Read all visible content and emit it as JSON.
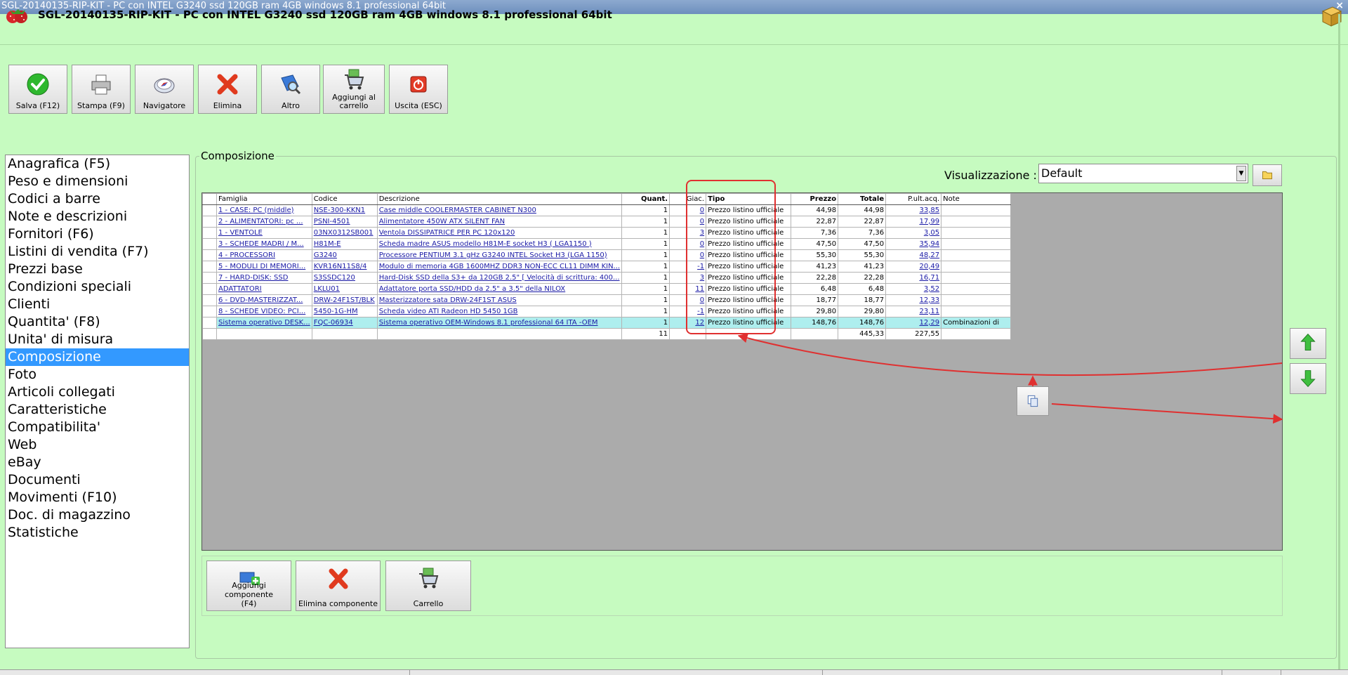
{
  "window": {
    "title": "SGL-20140135-RIP-KIT - PC con INTEL G3240 ssd 120GB ram 4GB windows 8.1 professional 64bit",
    "close_glyph": "×"
  },
  "header": {
    "title": "SGL-20140135-RIP-KIT - PC con INTEL G3240 ssd 120GB ram 4GB windows 8.1 professional 64bit"
  },
  "toolbar": {
    "save": "Salva (F12)",
    "print": "Stampa (F9)",
    "navigator": "Navigatore",
    "delete": "Elimina",
    "other": "Altro",
    "add_cart_1": "Aggiungi al",
    "add_cart_2": "carrello",
    "exit": "Uscita (ESC)"
  },
  "sidebar": {
    "items": [
      "Anagrafica (F5)",
      "Peso e dimensioni",
      "Codici a barre",
      "Note e descrizioni",
      "Fornitori (F6)",
      "Listini di vendita (F7)",
      "Prezzi base",
      "Condizioni speciali",
      "Clienti",
      "Quantita' (F8)",
      "Unita' di misura",
      "Composizione",
      "Foto",
      "Articoli collegati",
      "Caratteristiche",
      "Compatibilita'",
      "Web",
      "eBay",
      "Documenti",
      "Movimenti (F10)",
      "Doc. di magazzino",
      "Statistiche"
    ],
    "active_index": 11
  },
  "composizione": {
    "group_title": "Composizione",
    "view_label": "Visualizzazione :",
    "view_value": "Default",
    "columns": {
      "famiglia": "Famiglia",
      "codice": "Codice",
      "descrizione": "Descrizione",
      "quant": "Quant.",
      "giac": "Giac.",
      "tipo": "Tipo",
      "prezzo": "Prezzo",
      "totale": "Totale",
      "pultacq": "P.ult.acq.",
      "note": "Note"
    },
    "rows": [
      {
        "famiglia": "1 - CASE: PC (middle)",
        "codice": "NSE-300-KKN1",
        "descrizione": "Case middle COOLERMASTER CABINET N300",
        "quant": "1",
        "giac": "0",
        "tipo": "Prezzo listino ufficiale",
        "prezzo": "44,98",
        "totale": "44,98",
        "pultacq": "33,85",
        "note": ""
      },
      {
        "famiglia": "2 - ALIMENTATORI: pc ...",
        "codice": "PSNI-4501",
        "descrizione": "Alimentatore 450W ATX SILENT FAN",
        "quant": "1",
        "giac": "0",
        "tipo": "Prezzo listino ufficiale",
        "prezzo": "22,87",
        "totale": "22,87",
        "pultacq": "17,99",
        "note": ""
      },
      {
        "famiglia": "1 - VENTOLE",
        "codice": "03NX0312SB001",
        "descrizione": "Ventola DISSIPATRICE PER PC 120x120",
        "quant": "1",
        "giac": "3",
        "tipo": "Prezzo listino ufficiale",
        "prezzo": "7,36",
        "totale": "7,36",
        "pultacq": "3,05",
        "note": ""
      },
      {
        "famiglia": "3 - SCHEDE MADRI / M...",
        "codice": "H81M-E",
        "descrizione": "Scheda madre ASUS modello H81M-E socket H3 ( LGA1150 )",
        "quant": "1",
        "giac": "0",
        "tipo": "Prezzo listino ufficiale",
        "prezzo": "47,50",
        "totale": "47,50",
        "pultacq": "35,94",
        "note": ""
      },
      {
        "famiglia": "4 - PROCESSORI",
        "codice": "G3240",
        "descrizione": "Processore PENTIUM 3.1 gHz G3240 INTEL Socket H3 (LGA 1150)",
        "quant": "1",
        "giac": "0",
        "tipo": "Prezzo listino ufficiale",
        "prezzo": "55,30",
        "totale": "55,30",
        "pultacq": "48,27",
        "note": ""
      },
      {
        "famiglia": "5 - MODULI DI MEMORI...",
        "codice": "KVR16N11S8/4",
        "descrizione": "Modulo di memoria 4GB 1600MHZ DDR3 NON-ECC CL11 DIMM KIN...",
        "quant": "1",
        "giac": "-1",
        "tipo": "Prezzo listino ufficiale",
        "prezzo": "41,23",
        "totale": "41,23",
        "pultacq": "20,49",
        "note": ""
      },
      {
        "famiglia": "7 - HARD-DISK: SSD",
        "codice": "S3SSDC120",
        "descrizione": "Hard-Disk SSD della S3+ da 120GB 2.5\" [ Velocità di scrittura: 400...",
        "quant": "1",
        "giac": "3",
        "tipo": "Prezzo listino ufficiale",
        "prezzo": "22,28",
        "totale": "22,28",
        "pultacq": "16,71",
        "note": ""
      },
      {
        "famiglia": "ADATTATORI",
        "codice": "LKLU01",
        "descrizione": "Adattatore porta SSD/HDD da 2.5\" a 3.5\" della NILOX",
        "quant": "1",
        "giac": "11",
        "tipo": "Prezzo listino ufficiale",
        "prezzo": "6,48",
        "totale": "6,48",
        "pultacq": "3,52",
        "note": ""
      },
      {
        "famiglia": "6 - DVD-MASTERIZZAT...",
        "codice": "DRW-24F1ST/BLK",
        "descrizione": "Masterizzatore sata DRW-24F1ST ASUS",
        "quant": "1",
        "giac": "0",
        "tipo": "Prezzo listino ufficiale",
        "prezzo": "18,77",
        "totale": "18,77",
        "pultacq": "12,33",
        "note": ""
      },
      {
        "famiglia": "8 - SCHEDE VIDEO: PCI...",
        "codice": "5450-1G-HM",
        "descrizione": "Scheda video ATI Radeon HD 5450 1GB",
        "quant": "1",
        "giac": "-1",
        "tipo": "Prezzo listino ufficiale",
        "prezzo": "29,80",
        "totale": "29,80",
        "pultacq": "23,11",
        "note": ""
      },
      {
        "famiglia": "Sistema operativo DESK...",
        "codice": "FQC-06934",
        "descrizione": "Sistema operativo OEM-Windows 8.1 professional 64 ITA  -OEM",
        "quant": "1",
        "giac": "12",
        "tipo": "Prezzo listino ufficiale",
        "prezzo": "148,76",
        "totale": "148,76",
        "pultacq": "12,29",
        "note": "Combinazioni di"
      }
    ],
    "selected_row": 10,
    "totals": {
      "quant": "11",
      "totale": "445,33",
      "pultacq": "227,55"
    }
  },
  "bottom_buttons": {
    "add_component_1": "Aggiungi componente",
    "add_component_2": "(F4)",
    "delete_component": "Elimina componente",
    "cart": "Carrello"
  },
  "colors": {
    "background": "#c6fbc0",
    "selection": "#3399ff",
    "selected_row": "#aeeeee",
    "annotation": "#e03030",
    "link": "#1a1aa6"
  }
}
